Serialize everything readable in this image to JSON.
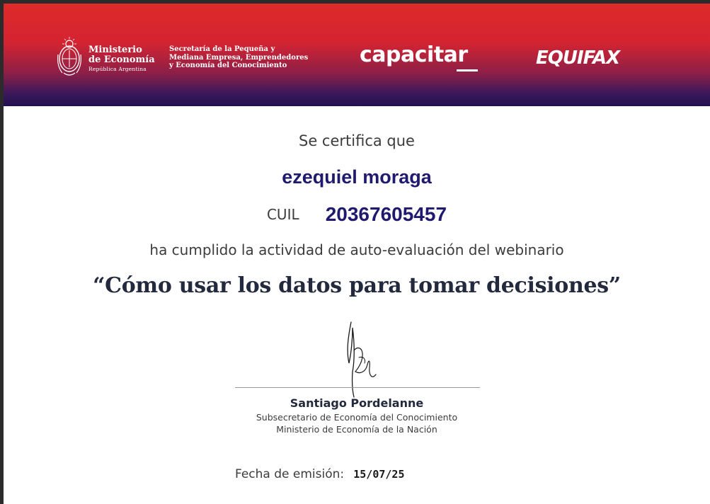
{
  "header": {
    "ministerio": {
      "line1": "Ministerio",
      "line2": "de Economía",
      "line3": "República Argentina"
    },
    "secretaria": {
      "line1": "Secretaría de la Pequeña y",
      "line2": "Mediana Empresa, Emprendedores",
      "line3": "y Economía del Conocimiento"
    },
    "capacitar_logo": "capacitar",
    "equifax_logo": "EQUIFAX",
    "header_colors": {
      "top": "#de2a2a",
      "bottom": "#22124f"
    }
  },
  "certificate": {
    "intro": "Se certifica que",
    "name": "ezequiel moraga",
    "cuil_label": "CUIL",
    "cuil_number": "20367605457",
    "activity": "ha cumplido la actividad de auto-evaluación del webinario",
    "webinar_title": "“Cómo usar los datos para tomar decisiones”",
    "accent_color": "#1f1a6e"
  },
  "signature": {
    "signer_name": "Santiago Pordelanne",
    "signer_role": "Subsecretario de Economía del Conocimiento",
    "signer_org": "Ministerio de Economía de la Nación"
  },
  "issue": {
    "label": "Fecha de emisión:",
    "date": "15/07/25"
  }
}
